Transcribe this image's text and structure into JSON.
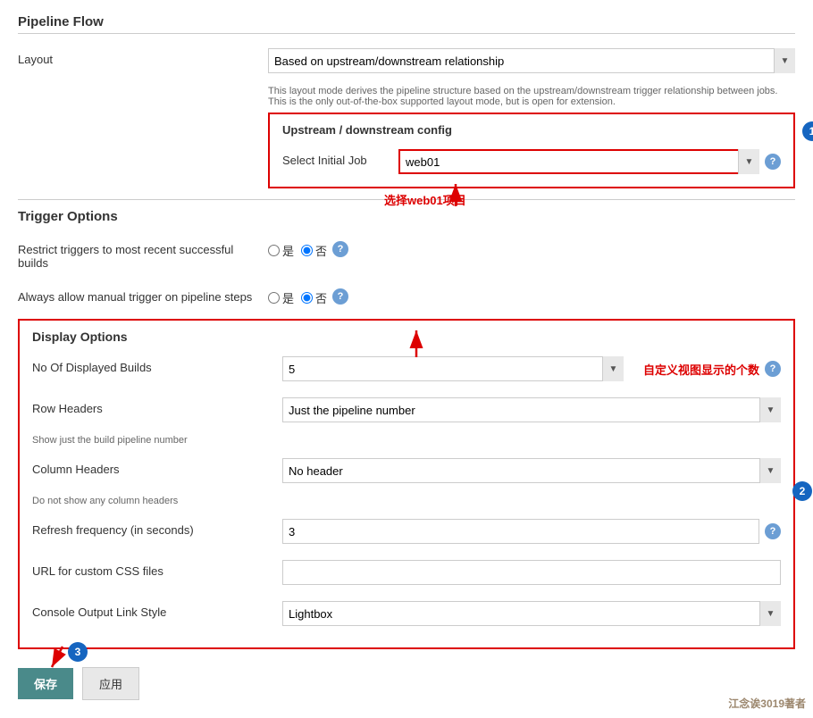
{
  "page": {
    "title": "Pipeline Flow",
    "layout_label": "Layout",
    "layout_value": "Based on upstream/downstream relationship",
    "layout_hint": "This layout mode derives the pipeline structure based on the upstream/downstream trigger relationship between jobs. This is the only out-of-the-box supported layout mode, but is open for extension.",
    "upstream_config": {
      "title": "Upstream / downstream config",
      "select_initial_job_label": "Select Initial Job",
      "select_initial_job_value": "web01",
      "annotation_text": "选择web01项目"
    },
    "trigger_options": {
      "title": "Trigger Options",
      "restrict_label": "Restrict triggers to most recent successful builds",
      "restrict_yes": "是",
      "restrict_no": "否",
      "restrict_value": "no",
      "always_allow_label": "Always allow manual trigger on pipeline steps",
      "always_allow_yes": "是",
      "always_allow_no": "否",
      "always_allow_value": "no"
    },
    "display_options": {
      "title": "Display Options",
      "no_of_builds_label": "No Of Displayed Builds",
      "no_of_builds_value": "5",
      "no_of_builds_annotation": "自定义视图显示的个数",
      "row_headers_label": "Row Headers",
      "row_headers_value": "Just the pipeline number",
      "row_headers_hint": "Show just the build pipeline number",
      "column_headers_label": "Column Headers",
      "column_headers_value": "No header",
      "column_headers_hint": "Do not show any column headers",
      "refresh_label": "Refresh frequency (in seconds)",
      "refresh_value": "3",
      "url_css_label": "URL for custom CSS files",
      "url_css_value": "",
      "console_output_label": "Console Output Link Style",
      "console_output_value": "Lightbox"
    },
    "buttons": {
      "save": "保存",
      "apply": "应用"
    },
    "annotations": {
      "circle1": "1",
      "circle2": "2",
      "circle3": "3"
    },
    "watermark": "江念诶3019著者"
  }
}
